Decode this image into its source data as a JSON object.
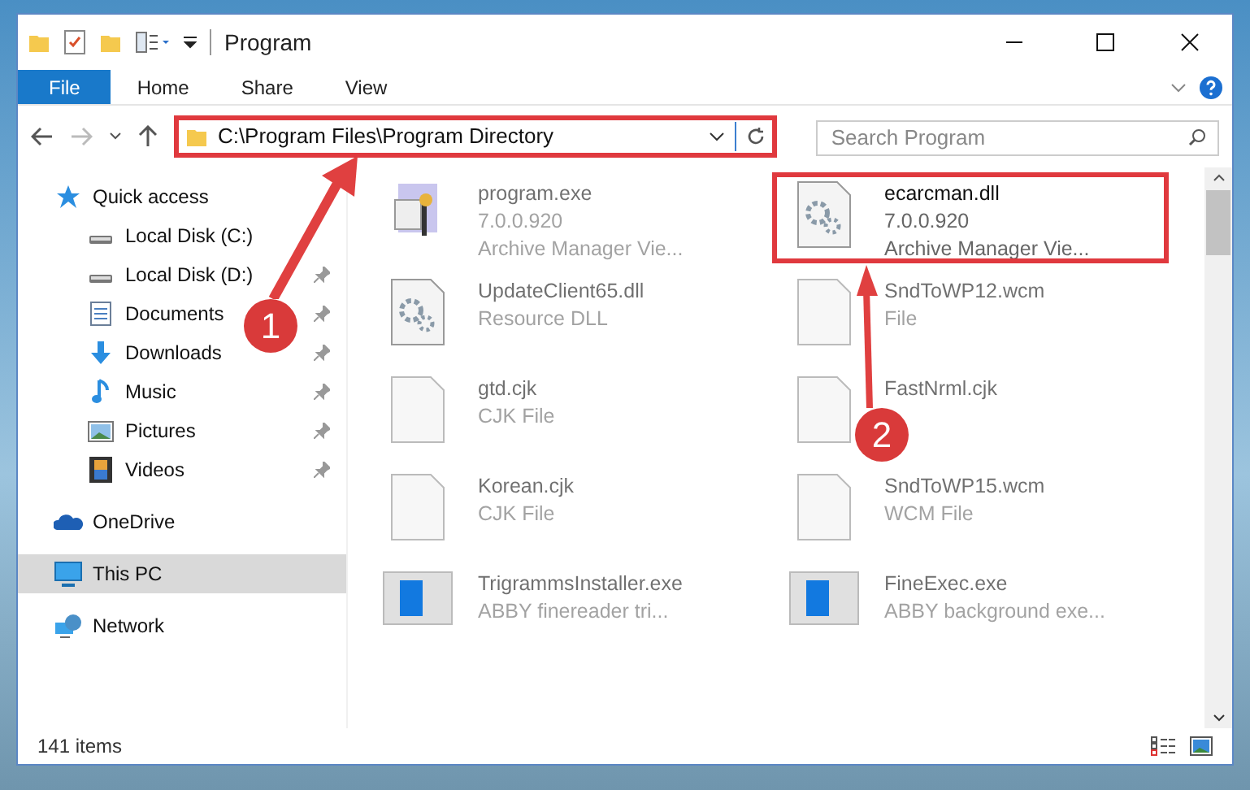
{
  "window": {
    "title": "Program"
  },
  "ribbon_tabs": [
    {
      "label": "File",
      "selected": true
    },
    {
      "label": "Home",
      "selected": false
    },
    {
      "label": "Share",
      "selected": false
    },
    {
      "label": "View",
      "selected": false
    }
  ],
  "address_bar": {
    "path": "C:\\Program Files\\Program Directory"
  },
  "search": {
    "placeholder": "Search Program"
  },
  "sidebar": {
    "items": [
      {
        "label": "Quick access",
        "kind": "star",
        "pinned": false,
        "selected": false,
        "children": [
          {
            "label": "Local Disk (C:)",
            "kind": "drive",
            "pinned": false,
            "selected": false
          },
          {
            "label": "Local Disk (D:)",
            "kind": "drive",
            "pinned": true,
            "selected": false
          },
          {
            "label": "Documents",
            "kind": "document",
            "pinned": true,
            "selected": false
          },
          {
            "label": "Downloads",
            "kind": "download",
            "pinned": true,
            "selected": false
          },
          {
            "label": "Music",
            "kind": "music",
            "pinned": true,
            "selected": false
          },
          {
            "label": "Pictures",
            "kind": "pictures",
            "pinned": true,
            "selected": false
          },
          {
            "label": "Videos",
            "kind": "video",
            "pinned": true,
            "selected": false
          }
        ]
      },
      {
        "label": "OneDrive",
        "kind": "cloud",
        "pinned": false,
        "selected": false
      },
      {
        "label": "This PC",
        "kind": "monitor",
        "pinned": false,
        "selected": true
      },
      {
        "label": "Network",
        "kind": "network",
        "pinned": false,
        "selected": false
      }
    ]
  },
  "files": [
    {
      "name": "program.exe",
      "details": [
        "7.0.0.920",
        "Archive Manager Vie..."
      ],
      "kind": "app",
      "faded": true,
      "highlighted": false
    },
    {
      "name": "ecarcman.dll",
      "details": [
        "7.0.0.920",
        "Archive Manager Vie..."
      ],
      "kind": "dll",
      "faded": false,
      "highlighted": true
    },
    {
      "name": "UpdateClient65.dll",
      "details": [
        "Resource DLL"
      ],
      "kind": "dll",
      "faded": true,
      "highlighted": false
    },
    {
      "name": "SndToWP12.wcm",
      "details": [
        "File"
      ],
      "kind": "blank",
      "faded": true,
      "highlighted": false
    },
    {
      "name": "gtd.cjk",
      "details": [
        "CJK File"
      ],
      "kind": "blank",
      "faded": true,
      "highlighted": false
    },
    {
      "name": "FastNrml.cjk",
      "kind": "blank",
      "faded": true,
      "highlighted": false
    },
    {
      "name": "Korean.cjk",
      "details": [
        "CJK File"
      ],
      "kind": "blank",
      "faded": true,
      "highlighted": false
    },
    {
      "name": "SndToWP15.wcm",
      "details": [
        "WCM File"
      ],
      "kind": "blank",
      "faded": true,
      "highlighted": false
    },
    {
      "name": "TrigrammsInstaller.exe",
      "details": [
        "ABBY finereader tri..."
      ],
      "kind": "window",
      "faded": true,
      "highlighted": false
    },
    {
      "name": "FineExec.exe",
      "details": [
        "ABBY background exe..."
      ],
      "kind": "window",
      "faded": true,
      "highlighted": false
    }
  ],
  "status_bar": {
    "item_count": "141 items"
  },
  "annotations": [
    {
      "number": "1"
    },
    {
      "number": "2"
    }
  ]
}
